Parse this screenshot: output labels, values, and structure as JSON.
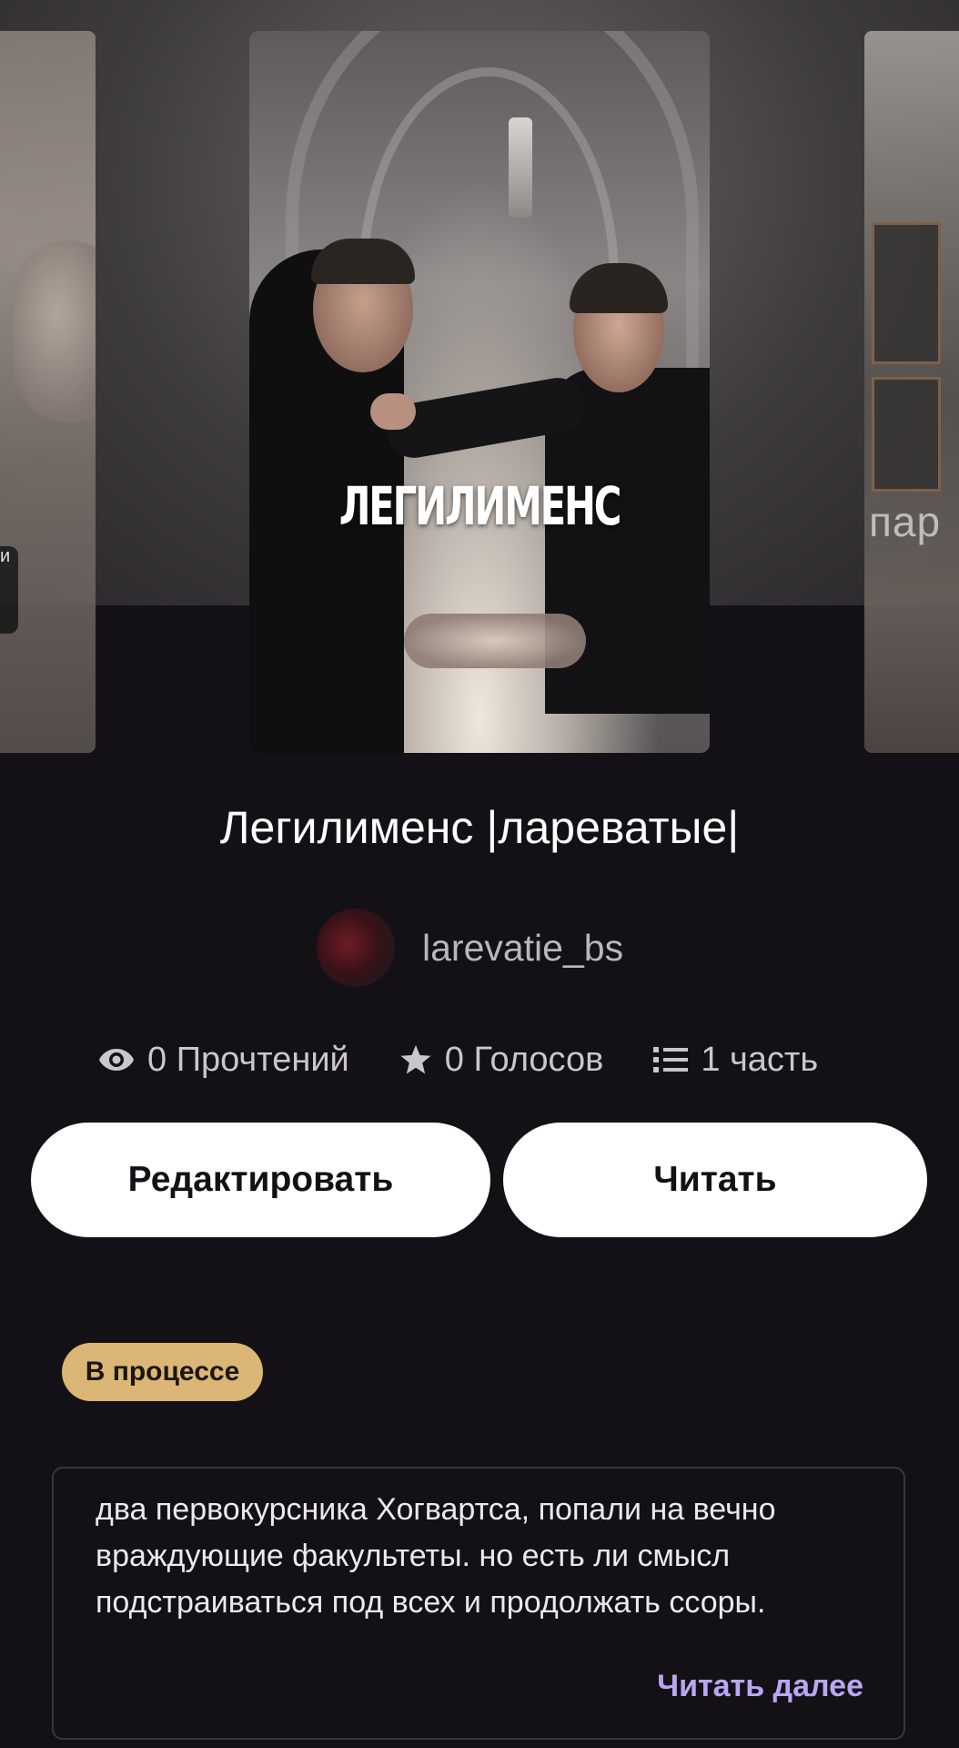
{
  "cover": {
    "overlay_text": "ЛЕГИЛИМЕНС",
    "side_right_text": "пар",
    "side_left_text": "и"
  },
  "story": {
    "title": "Легилименс |лареватые|",
    "author": "larevatie_bs"
  },
  "stats": {
    "reads": "0 Прочтений",
    "votes": "0 Голосов",
    "parts": "1 часть"
  },
  "actions": {
    "edit_label": "Редактировать",
    "read_label": "Читать"
  },
  "status_badge": "В процессе",
  "description": {
    "text": "два первокурсника Хогвартса, попали на вечно враждующие факультеты. но есть ли смысл подстраиваться под всех и продолжать ссоры.",
    "read_more": "Читать далее"
  },
  "colors": {
    "background": "#141116",
    "badge": "#dcb676",
    "read_more": "#b9a6f3",
    "button": "#ffffff"
  }
}
